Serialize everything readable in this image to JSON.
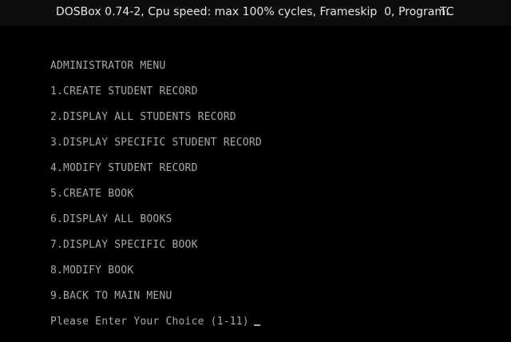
{
  "window": {
    "title": "DOSBox 0.74-2, Cpu speed: max 100% cycles, Frameskip  0, Program:",
    "program": "TC"
  },
  "screen": {
    "menu_title": "ADMINISTRATOR MENU",
    "items": [
      "1.CREATE STUDENT RECORD",
      "2.DISPLAY ALL STUDENTS RECORD",
      "3.DISPLAY SPECIFIC STUDENT RECORD",
      "4.MODIFY STUDENT RECORD",
      "5.CREATE BOOK",
      "6.DISPLAY ALL BOOKS",
      "7.DISPLAY SPECIFIC BOOK",
      "8.MODIFY BOOK",
      "9.BACK TO MAIN MENU"
    ],
    "prompt": "Please Enter Your Choice (1-11)"
  },
  "colors": {
    "text": "#a8a8a8",
    "background": "#000000",
    "titlebar": "#0d0d0d"
  }
}
